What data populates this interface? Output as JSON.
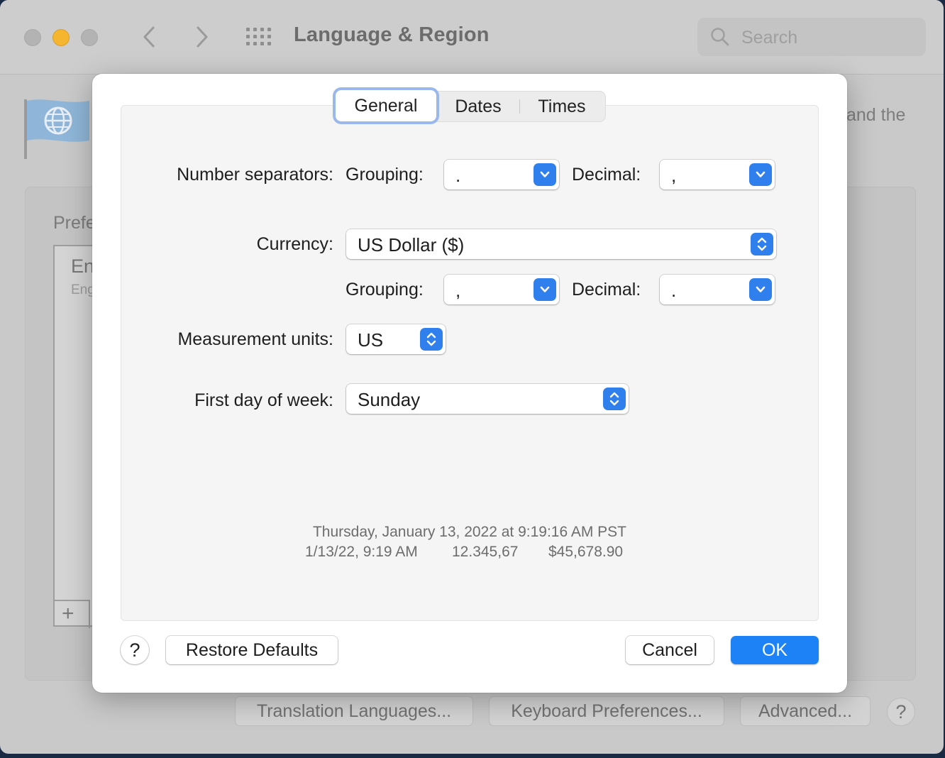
{
  "window": {
    "title": "Language & Region",
    "search_placeholder": "Search",
    "description_fragment": "and the",
    "preferred_label_fragment": "Prefe",
    "language_item_title_fragment": "En",
    "language_item_subtitle_fragment": "Eng",
    "add_symbol": "+",
    "buttons": {
      "translation": "Translation Languages...",
      "keyboard": "Keyboard Preferences...",
      "advanced": "Advanced...",
      "help": "?"
    }
  },
  "dialog": {
    "tabs": [
      {
        "label": "General",
        "selected": true
      },
      {
        "label": "Dates",
        "selected": false
      },
      {
        "label": "Times",
        "selected": false
      }
    ],
    "number_separators": {
      "label": "Number separators:",
      "grouping_label": "Grouping:",
      "grouping_value": ".",
      "decimal_label": "Decimal:",
      "decimal_value": ","
    },
    "currency": {
      "label": "Currency:",
      "value": "US Dollar ($)",
      "grouping_label": "Grouping:",
      "grouping_value": ",",
      "decimal_label": "Decimal:",
      "decimal_value": "."
    },
    "measurement": {
      "label": "Measurement units:",
      "value": "US"
    },
    "first_day": {
      "label": "First day of week:",
      "value": "Sunday"
    },
    "preview": {
      "long_date": "Thursday, January 13, 2022 at 9:19:16 AM PST",
      "short_date": "1/13/22, 9:19 AM",
      "number": "12.345,67",
      "currency": "$45,678.90"
    },
    "buttons": {
      "help": "?",
      "restore": "Restore Defaults",
      "cancel": "Cancel",
      "ok": "OK"
    }
  },
  "colors": {
    "accent": "#1d82f5",
    "popup_chevron": "#2f80ed",
    "traffic_minimize": "#f5b52e",
    "focus_ring": "#9bb8ec"
  },
  "icons": {
    "back": "chevron-left-icon",
    "forward": "chevron-right-icon",
    "grid": "grid-icon",
    "search": "search-icon",
    "flag": "globe-flag-icon",
    "popup_down": "chevron-down-icon",
    "popup_updown": "chevron-up-down-icon"
  }
}
